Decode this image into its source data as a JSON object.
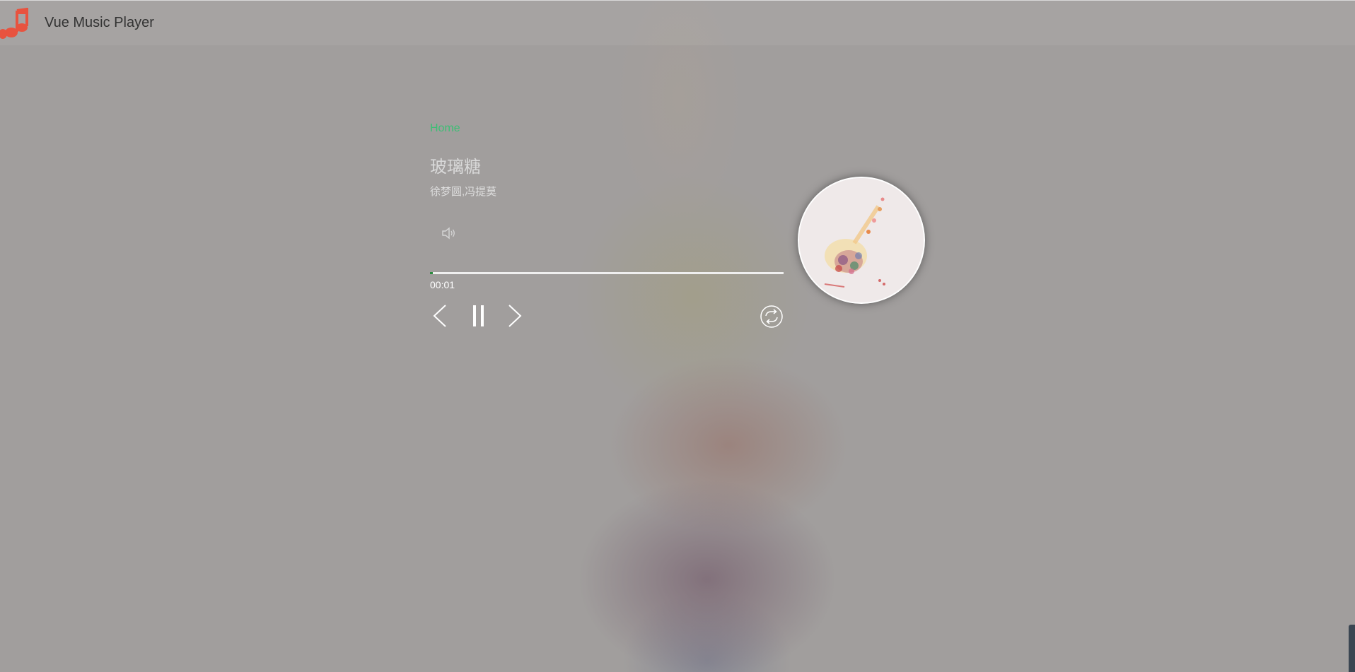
{
  "app": {
    "title": "Vue Music Player",
    "logo_icon": "music-note-icon",
    "logo_color": "#e8533f"
  },
  "nav": {
    "home_label": "Home"
  },
  "song": {
    "title": "玻璃糖",
    "artist": "徐梦圆,冯提莫"
  },
  "player": {
    "current_time": "00:01",
    "progress_fraction": 0.007,
    "progress_color": "#2b8a3e",
    "accent_color": "#3bbf74",
    "controls": {
      "volume_icon": "speaker-icon",
      "prev_icon": "chevron-left-icon",
      "pause_icon": "pause-icon",
      "next_icon": "chevron-right-icon",
      "loop_icon": "loop-icon"
    }
  }
}
